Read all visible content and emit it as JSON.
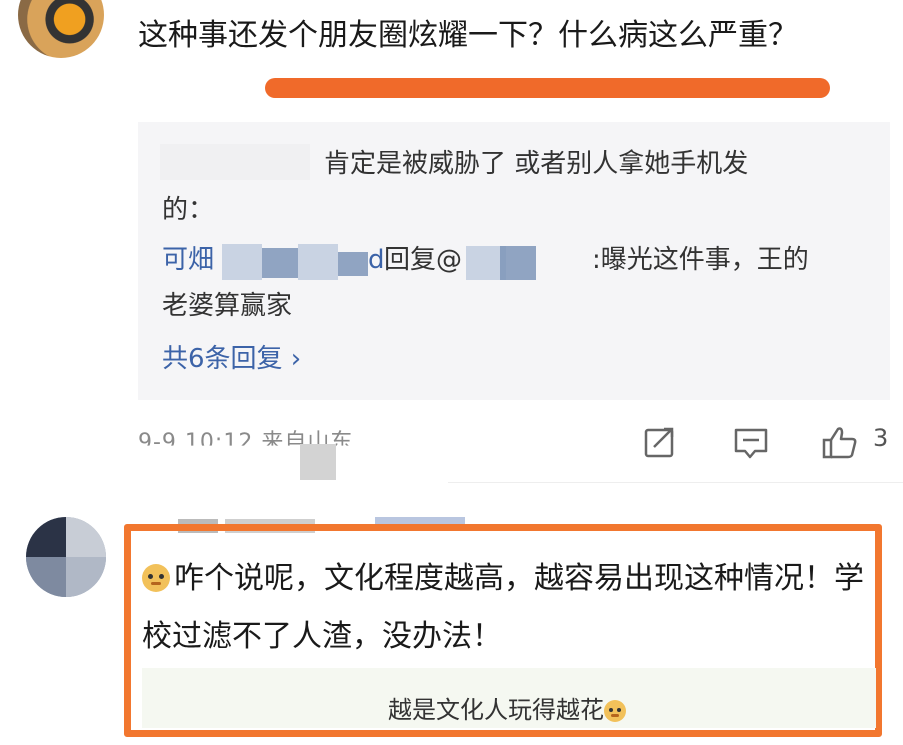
{
  "comment1": {
    "text": "这种事还发个朋友圈炫耀一下？什么病这么严重？"
  },
  "reply_box": {
    "reply1": {
      "text_line1": "肯定是被威胁了 或者别人拿她手机发",
      "text_line2": "的："
    },
    "reply2": {
      "user_prefix": "可畑",
      "reply_word": "回复@",
      "user_suffix": "d",
      "text_line1": ":曝光这件事，王的",
      "text_line2": "老婆算赢家"
    },
    "more_replies": "共6条回复 ›"
  },
  "meta": {
    "time_location": "9-9 10:12 来自山东"
  },
  "actions": {
    "share_icon": "share-icon",
    "comment_icon": "comment-icon",
    "like_icon": "like-icon",
    "like_count": "3"
  },
  "comment2": {
    "text": "咋个说呢，文化程度越高，越容易出现这种情况！学校过滤不了人渣，没办法！",
    "sub_caption": "越是文化人玩得越花"
  },
  "colors": {
    "highlight": "#f2772f",
    "link": "#3c63a8",
    "reply_bg": "#f5f5f7"
  }
}
